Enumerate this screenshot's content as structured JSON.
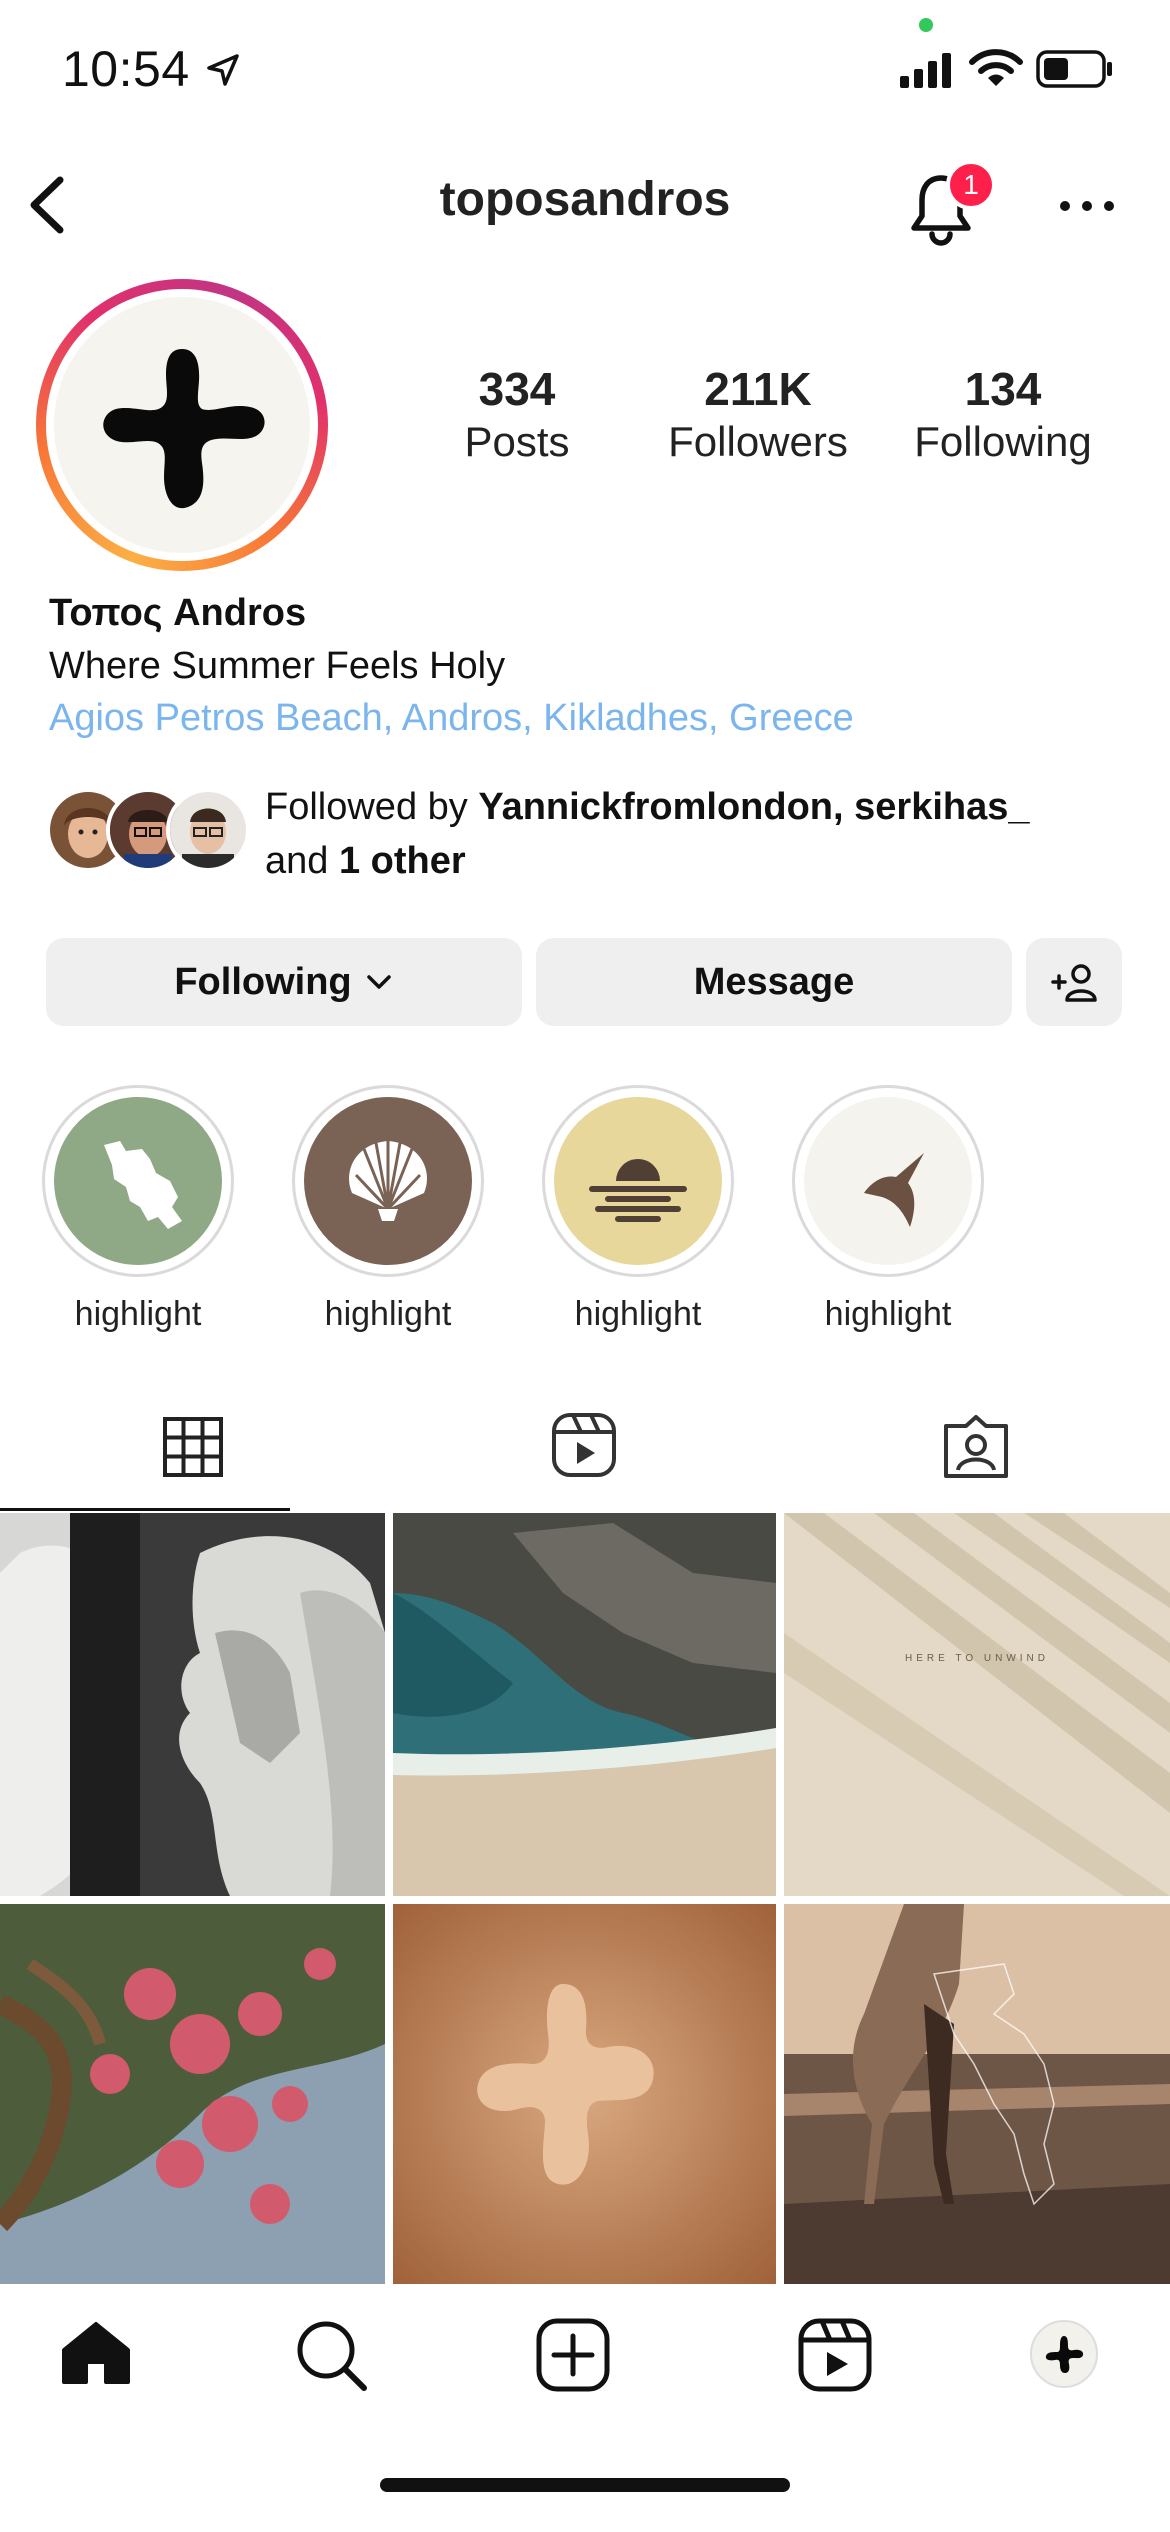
{
  "status_bar": {
    "time": "10:54"
  },
  "header": {
    "username": "toposandros",
    "notification_count": "1"
  },
  "profile": {
    "stats": [
      {
        "value": "334",
        "label": "Posts"
      },
      {
        "value": "211K",
        "label": "Followers"
      },
      {
        "value": "134",
        "label": "Following"
      }
    ],
    "display_name": "Τοπος Andros",
    "tagline": "Where Summer Feels Holy",
    "location": "Agios Petros Beach, Andros, Kikladhes, Greece",
    "followed_by": {
      "prefix": "Followed by ",
      "names": "Yannickfromlondon, serkihas_",
      "and": "and ",
      "others": "1 other"
    }
  },
  "actions": {
    "following_label": "Following",
    "message_label": "Message"
  },
  "highlights": [
    {
      "label": "highlight",
      "color": "#8fa885",
      "icon": "island-map-icon"
    },
    {
      "label": "highlight",
      "color": "#7a6354",
      "icon": "seashell-icon"
    },
    {
      "label": "highlight",
      "color": "#e8d79a",
      "icon": "sunset-icon"
    },
    {
      "label": "highlight",
      "color": "#f5f3ee",
      "icon": "bird-icon"
    }
  ],
  "tabs": [
    "grid-tab",
    "reels-tab",
    "tagged-tab"
  ],
  "posts": [
    {
      "name": "post-statues",
      "overlay_text": ""
    },
    {
      "name": "post-beach-rocks",
      "overlay_text": ""
    },
    {
      "name": "post-palm-shadow",
      "overlay_text": "HERE TO UNWIND"
    },
    {
      "name": "post-bougainvillea",
      "overlay_text": ""
    },
    {
      "name": "post-sand-cross",
      "overlay_text": ""
    },
    {
      "name": "post-sea-walk",
      "overlay_text": ""
    }
  ],
  "colors": {
    "link": "#7bb5ee",
    "badge": "#ff1f4b",
    "button_bg": "#efefef"
  }
}
